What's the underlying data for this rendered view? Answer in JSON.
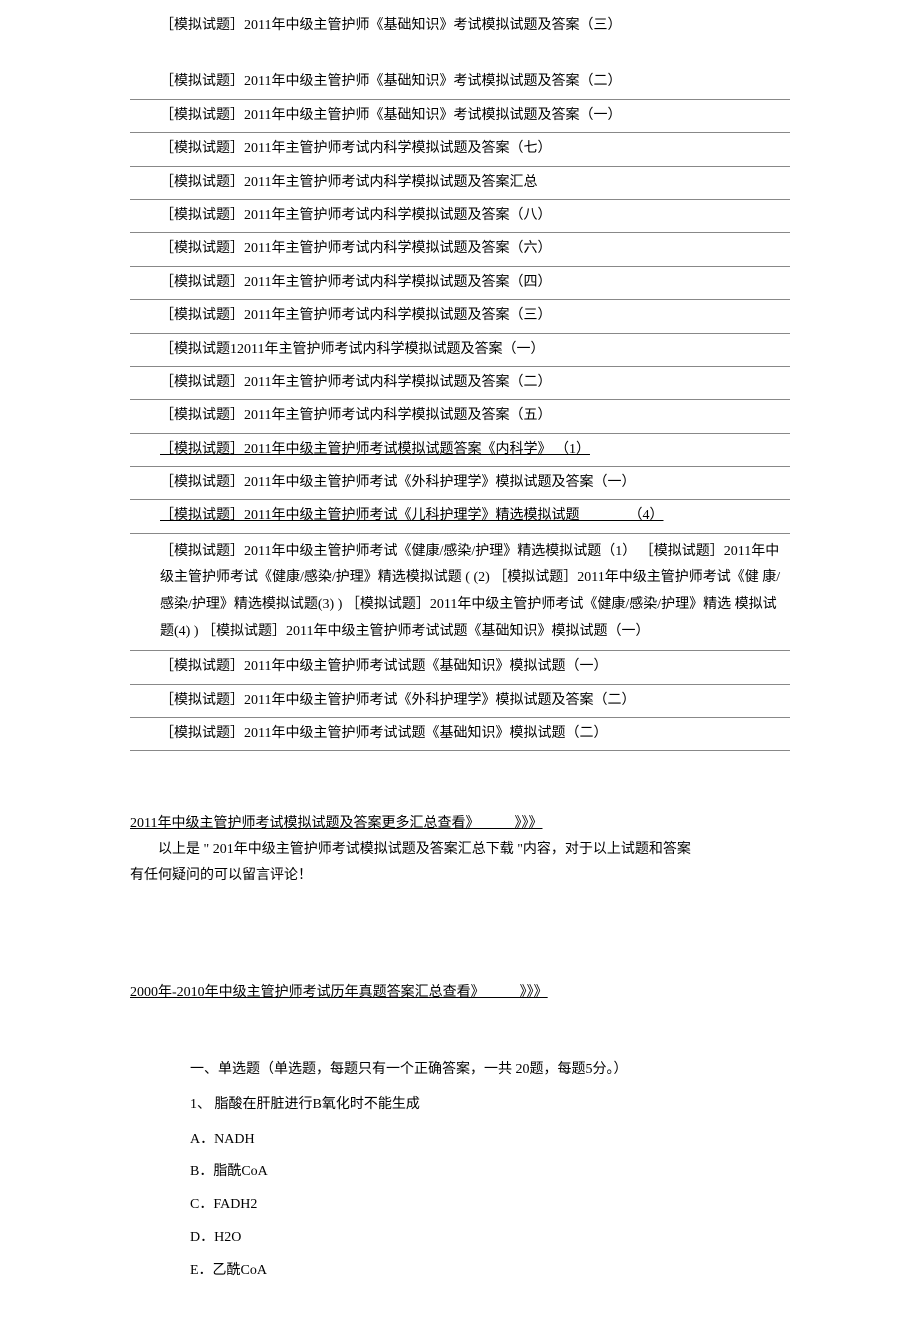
{
  "links": {
    "item0": "［模拟试题］2011年中级主管护师《基础知识》考试模拟试题及答案（三）",
    "item1": "［模拟试题］2011年中级主管护师《基础知识》考试模拟试题及答案（二）",
    "item2": "［模拟试题］2011年中级主管护师《基础知识》考试模拟试题及答案（一）",
    "item3": "［模拟试题］2011年主管护师考试内科学模拟试题及答案（七）",
    "item4": "［模拟试题］2011年主管护师考试内科学模拟试题及答案汇总",
    "item5": "［模拟试题］2011年主管护师考试内科学模拟试题及答案（八）",
    "item6": "［模拟试题］2011年主管护师考试内科学模拟试题及答案（六）",
    "item7": "［模拟试题］2011年主管护师考试内科学模拟试题及答案（四）",
    "item8": "［模拟试题］2011年主管护师考试内科学模拟试题及答案（三）",
    "item9": "［模拟试题12011年主管护师考试内科学模拟试题及答案（一）",
    "item10": "［模拟试题］2011年主管护师考试内科学模拟试题及答案（二）",
    "item11": "［模拟试题］2011年主管护师考试内科学模拟试题及答案（五）",
    "item12": "［模拟试题］2011年中级主管护师考试模拟试题答案《内科学》   （1）",
    "item13": "［模拟试题］2011年中级主管护师考试《外科护理学》模拟试题及答案（一）",
    "item14": "［模拟试题］2011年中级主管护师考试《儿科护理学》精选模拟试题              （4）",
    "paragraph": "［模拟试题］2011年中级主管护师考试《健康/感染/护理》精选模拟试题（1） ［模拟试题］2011年中级主管护师考试《健康/感染/护理》精选模拟试题 ( (2) ［模拟试题］2011年中级主管护师考试《健 康/感染/护理》精选模拟试题(3) )   ［模拟试题］2011年中级主管护师考试《健康/感染/护理》精选 模拟试题(4) ) ［模拟试题］2011年中级主管护师考试试题《基础知识》模拟试题（一）",
    "item15": "［模拟试题］2011年中级主管护师考试试题《基础知识》模拟试题（一）",
    "item16": "［模拟试题］2011年中级主管护师考试《外科护理学》模拟试题及答案（二）",
    "item17": "［模拟试题］2011年中级主管护师考试试题《基础知识》模拟试题（二）"
  },
  "summary1": "2011年中级主管护师考试模拟试题及答案更多汇总查看》          》》》",
  "note1": "以上是 \" 201年中级主管护师考试模拟试题及答案汇总下载       \"内容，对于以上试题和答案",
  "note2": "有任何疑问的可以留言评论！",
  "summary2": "2000年-2010年中级主管护师考试历年真题答案汇总查看》          》》》",
  "quiz": {
    "heading": "一、单选题（单选题，每题只有一个正确答案，一共  20题，每题5分。）",
    "question": "1、   脂酸在肝脏进行B氧化时不能生成",
    "optA": "A．NADH",
    "optB": "B．脂酰CoA",
    "optC": "C．FADH2",
    "optD": "D．H2O",
    "optE": "E．乙酰CoA"
  }
}
